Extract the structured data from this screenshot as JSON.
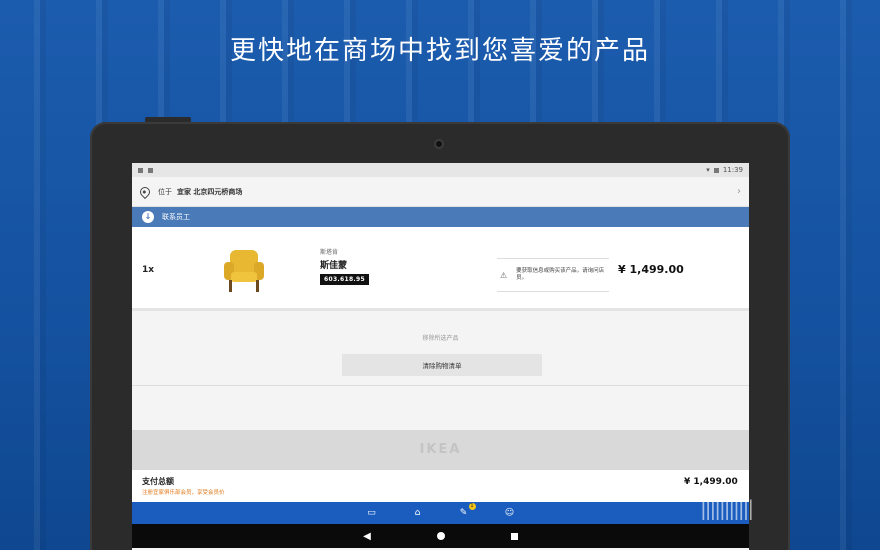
{
  "headline": "更快地在商场中找到您喜爱的产品",
  "statusbar": {
    "time": "11:39"
  },
  "location": {
    "prefix": "位于",
    "store": "宜家 北京四元桥商场",
    "arrow": "›"
  },
  "contact_bar": {
    "label": "联系员工",
    "icon": "down-arrow-icon"
  },
  "product": {
    "quantity": "1x",
    "series": "斯塔肯",
    "name": "斯佳蒙",
    "article_number": "603.618.95",
    "notice": "要获取信息或购买该产品，请询问店员。",
    "price": "¥ 1,499.00",
    "chair_color": "#e8b833"
  },
  "actions": {
    "remove_link": "移除所选产品",
    "clear_button": "清除购物清单"
  },
  "brand": {
    "logo_text": "IKEA"
  },
  "total": {
    "label": "支付总额",
    "sub": "注册宜家俱乐部会员，享受会员价",
    "price": "¥ 1,499.00"
  },
  "bottom_nav": {
    "items": [
      "store-map-icon",
      "products-icon",
      "shopping-list-icon",
      "profile-icon"
    ],
    "badge": "1"
  },
  "system_nav": {
    "back": "◀"
  },
  "colors": {
    "background_blue": "#14519f",
    "accent_blue": "#4a7ab8",
    "nav_blue": "#1a5dbf",
    "offer_orange": "#e07a1a"
  }
}
